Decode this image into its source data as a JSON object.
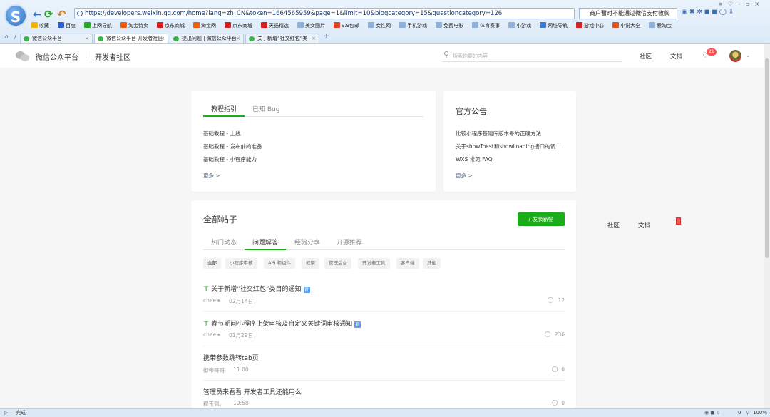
{
  "browser": {
    "url": "https://developers.weixin.qq.com/home?lang=zh_CN&token=1664565959&page=1&limit=10&blogcategory=15&questioncategory=126",
    "search_text": "商户暂时不能通过微信支付收款",
    "logo_letter": "S",
    "bookmarks": [
      {
        "label": "收藏",
        "color": "#f5b400"
      },
      {
        "label": "百度",
        "color": "#2b5dd8"
      },
      {
        "label": "上网导航",
        "color": "#2aa62a"
      },
      {
        "label": "淘宝特卖",
        "color": "#f45b00"
      },
      {
        "label": "京东商城",
        "color": "#d71d1d"
      },
      {
        "label": "淘宝网",
        "color": "#f45b00"
      },
      {
        "label": "京东商城",
        "color": "#d71d1d"
      },
      {
        "label": "天猫精选",
        "color": "#d71d1d"
      },
      {
        "label": "美女图片",
        "color": "#8fb0d8"
      },
      {
        "label": "9.9包邮",
        "color": "#e0441e"
      },
      {
        "label": "女性网",
        "color": "#8fb0d8"
      },
      {
        "label": "手机游戏",
        "color": "#8fb0d8"
      },
      {
        "label": "免费电影",
        "color": "#8fb0d8"
      },
      {
        "label": "体育赛事",
        "color": "#8fb0d8"
      },
      {
        "label": "小游戏",
        "color": "#8fb0d8"
      },
      {
        "label": "网址导航",
        "color": "#3a7bd5"
      },
      {
        "label": "游戏中心",
        "color": "#d42222"
      },
      {
        "label": "小说大全",
        "color": "#e8501a"
      },
      {
        "label": "爱淘宝",
        "color": "#8fb0d8"
      }
    ],
    "tabs": [
      {
        "label": "微信公众平台",
        "active": false
      },
      {
        "label": "微信公众平台 开发者社区",
        "active": true
      },
      {
        "label": "提出问题 | 微信公众平台",
        "active": false
      },
      {
        "label": "关于新增“社交红包”类",
        "active": false
      }
    ],
    "status_text": "完成",
    "zoom": "100%",
    "download_count": "0"
  },
  "site": {
    "brand": "微信公众平台",
    "section": "开发者社区",
    "search_placeholder": "搜索你要的内容",
    "nav": [
      "社区",
      "文档"
    ],
    "notification_count": "21"
  },
  "tutorial": {
    "tabs": [
      "教程指引",
      "已知 Bug"
    ],
    "links": [
      "基础教程 - 上线",
      "基础教程 - 发布前的准备",
      "基础教程 - 小程序能力"
    ],
    "more": "更多 >"
  },
  "announcements": {
    "title": "官方公告",
    "links": [
      "比较小程序基础库版本号的正确方法",
      "关于showToast和showLoading接口的调...",
      "WXS 常见 FAQ"
    ],
    "more": "更多 >"
  },
  "posts": {
    "title": "全部帖子",
    "new_post_button": "/ 发表新帖",
    "tabs": [
      "热门动态",
      "问题解答",
      "经验分享",
      "开源推荐"
    ],
    "active_tab": 1,
    "filters": [
      "全部",
      "小程序审核",
      "API 和组件",
      "框架",
      "管理后台",
      "开发者工具",
      "客户端",
      "其他"
    ],
    "items": [
      {
        "title": "关于新增“社交红包”类目的通知",
        "pinned": true,
        "official": true,
        "author": "chee❧",
        "date": "02月14日",
        "comments": "12"
      },
      {
        "title": "春节期间小程序上架审核及自定义关键词审核通知",
        "pinned": true,
        "official": true,
        "author": "chee❧",
        "date": "01月29日",
        "comments": "236"
      },
      {
        "title": "携带参数跳转tab页",
        "pinned": false,
        "official": false,
        "author": "御帝哥哥",
        "date": "11:00",
        "comments": "0"
      },
      {
        "title": "管理员来看看 开发者工具还能用么",
        "pinned": false,
        "official": false,
        "author": "穆玉佩。",
        "date": "10:58",
        "comments": "0"
      }
    ],
    "official_badge": "官"
  },
  "floating_nav": [
    "社区",
    "文档"
  ],
  "colors": {
    "accent": "#1aad19",
    "link": "#576b95",
    "badge": "#fa5151"
  }
}
